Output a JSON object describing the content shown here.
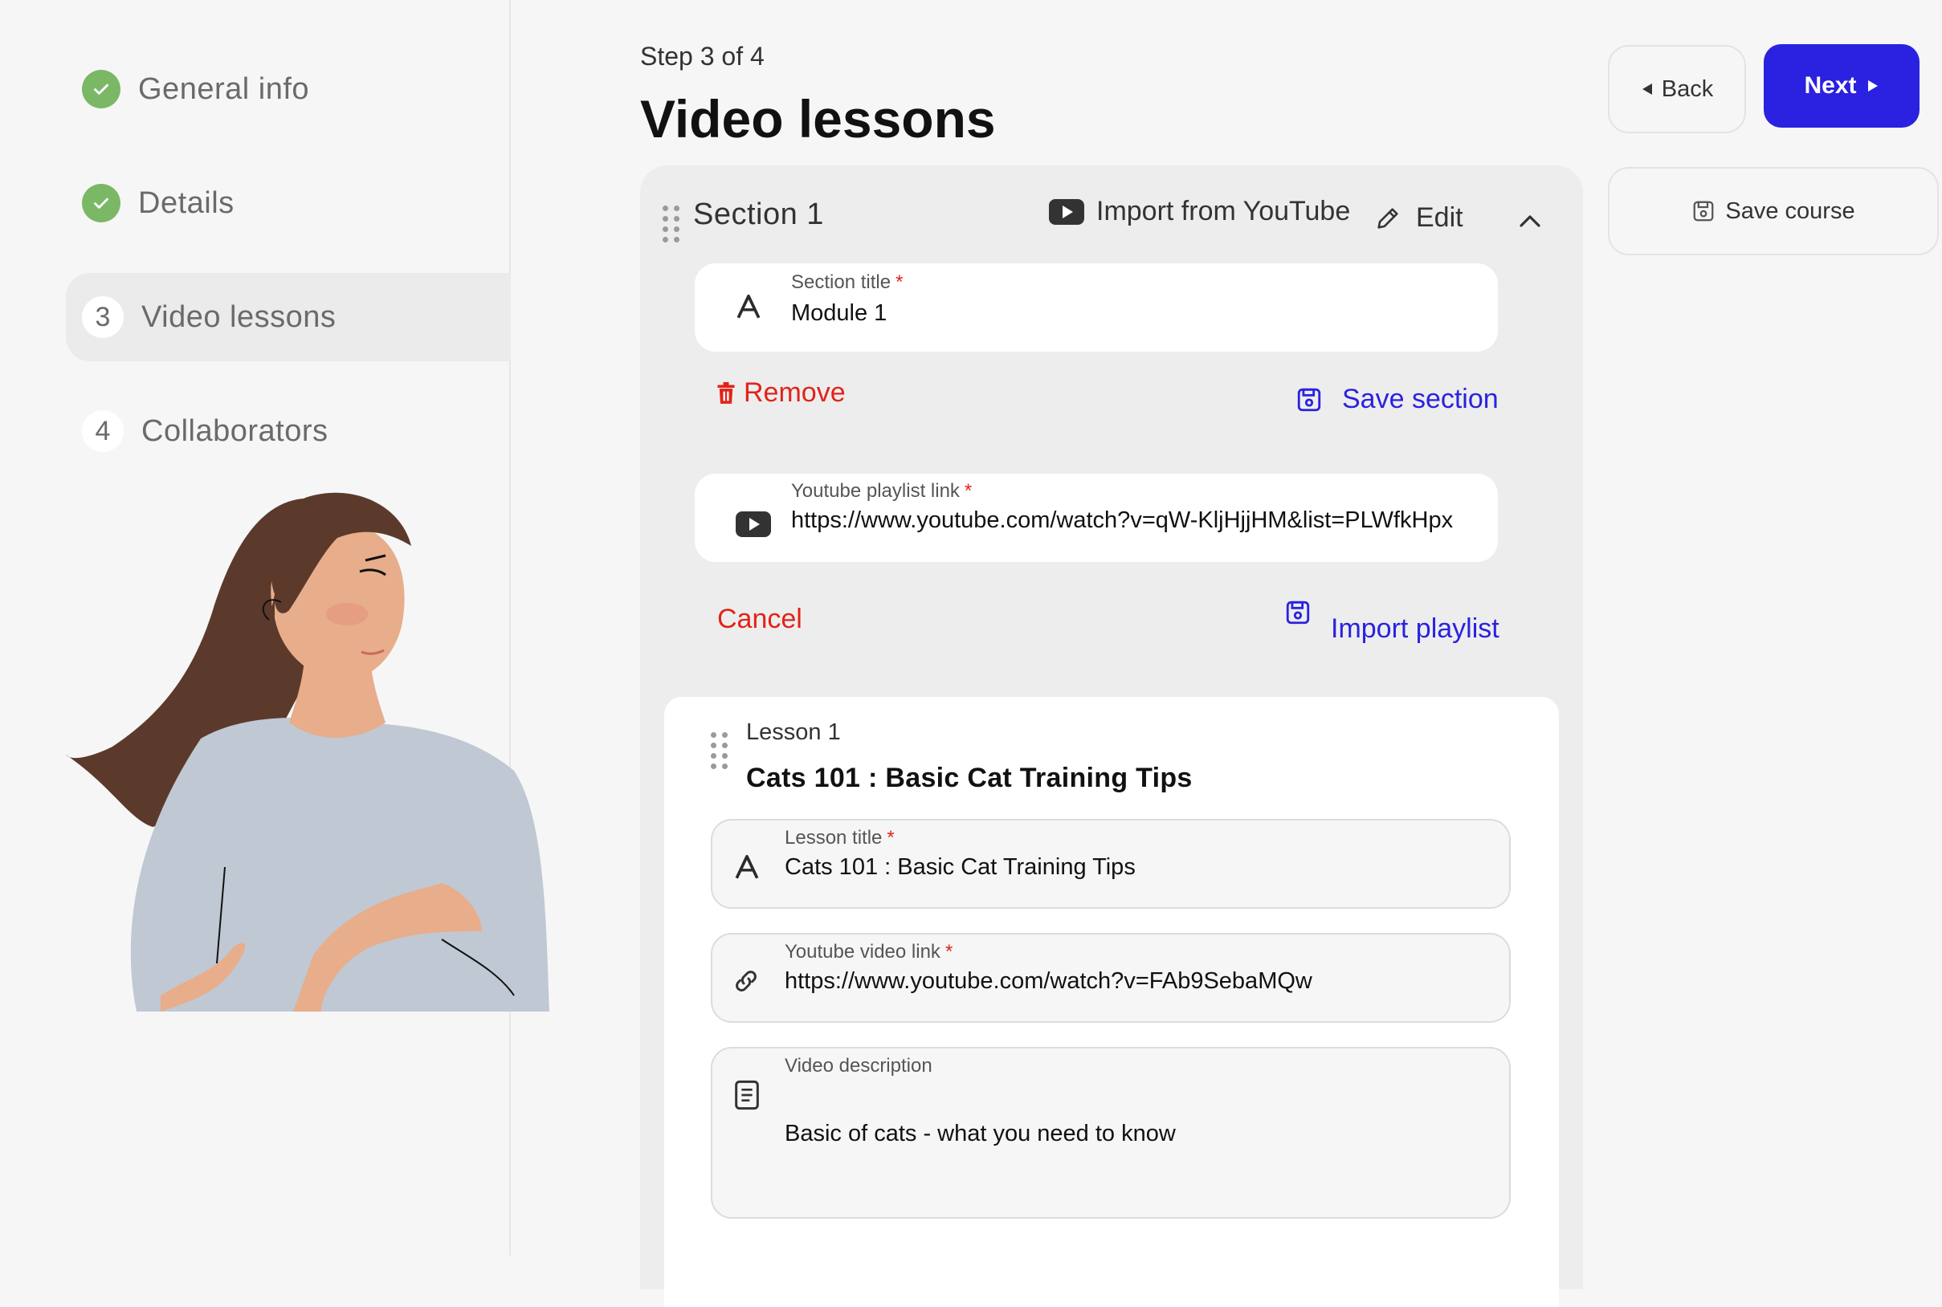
{
  "steps": [
    {
      "label": "General info",
      "state": "done"
    },
    {
      "label": "Details",
      "state": "done"
    },
    {
      "number": "3",
      "label": "Video lessons",
      "state": "active"
    },
    {
      "number": "4",
      "label": "Collaborators",
      "state": "pending"
    }
  ],
  "header": {
    "step_counter": "Step 3 of 4",
    "title": "Video lessons",
    "back_label": "Back",
    "next_label": "Next",
    "save_course_label": "Save course"
  },
  "section": {
    "title": "Section 1",
    "import_youtube_label": "Import from YouTube",
    "edit_label": "Edit",
    "section_title_field": {
      "label": "Section title",
      "required": "*",
      "value": "Module 1"
    },
    "remove_label": "Remove",
    "save_section_label": "Save section",
    "playlist_field": {
      "label": "Youtube playlist link",
      "required": "*",
      "value": "https://www.youtube.com/watch?v=qW-KljHjjHM&list=PLWfkHpx"
    },
    "cancel_label": "Cancel",
    "import_playlist_label": "Import playlist"
  },
  "lesson": {
    "number_label": "Lesson 1",
    "heading": "Cats 101 : Basic Cat Training Tips",
    "title_field": {
      "label": "Lesson title",
      "required": "*",
      "value": "Cats 101 : Basic Cat Training Tips"
    },
    "video_field": {
      "label": "Youtube video link",
      "required": "*",
      "value": "https://www.youtube.com/watch?v=FAb9SebaMQw"
    },
    "description_field": {
      "label": "Video description",
      "value": "Basic of cats - what you need to know"
    }
  },
  "colors": {
    "primary": "#2a22e0",
    "danger": "#e2231a",
    "success": "#7ab865",
    "background": "#f6f6f6",
    "panel": "#ededed"
  }
}
